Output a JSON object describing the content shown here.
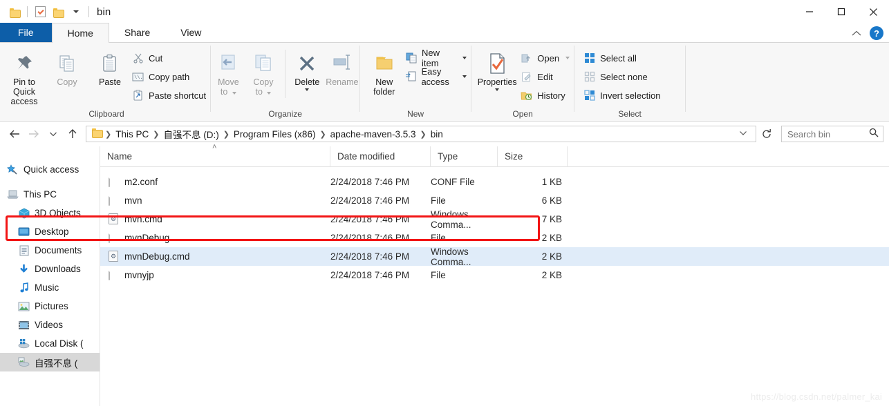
{
  "window": {
    "title": "bin",
    "quick_access_icons": [
      "folder-icon",
      "properties-check-icon",
      "new-folder-icon",
      "customize-caret-icon"
    ],
    "controls": {
      "minimize": "—",
      "maximize": "□",
      "close": "✕"
    }
  },
  "ribbon": {
    "tabs": [
      {
        "label": "File",
        "state": "file"
      },
      {
        "label": "Home",
        "state": "active"
      },
      {
        "label": "Share",
        "state": "normal"
      },
      {
        "label": "View",
        "state": "normal"
      }
    ],
    "collapse_icon": "chevron-up-icon",
    "help_label": "?",
    "groups": [
      {
        "name": "Clipboard",
        "big": [
          {
            "label_line1": "Pin to Quick",
            "label_line2": "access",
            "icon": "pin-icon",
            "dim": false
          },
          {
            "label_line1": "Copy",
            "label_line2": "",
            "icon": "copy-icon",
            "dim": true
          },
          {
            "label_line1": "Paste",
            "label_line2": "",
            "icon": "paste-icon",
            "dim": false
          }
        ],
        "small": [
          {
            "label": "Cut",
            "icon": "scissors-icon",
            "dim": true,
            "caret": false
          },
          {
            "label": "Copy path",
            "icon": "copy-path-icon",
            "dim": false,
            "caret": false
          },
          {
            "label": "Paste shortcut",
            "icon": "paste-shortcut-icon",
            "dim": true,
            "caret": false
          }
        ]
      },
      {
        "name": "Organize",
        "big": [
          {
            "label_line1": "Move",
            "label_line2": "to",
            "icon": "move-to-icon",
            "dim": true,
            "caret": true
          },
          {
            "label_line1": "Copy",
            "label_line2": "to",
            "icon": "copy-to-icon",
            "dim": true,
            "caret": true
          },
          {
            "label_line1": "Delete",
            "label_line2": "",
            "icon": "delete-x-icon",
            "dim": false,
            "caret": true
          },
          {
            "label_line1": "Rename",
            "label_line2": "",
            "icon": "rename-icon",
            "dim": true,
            "caret": false
          }
        ],
        "small": []
      },
      {
        "name": "New",
        "big": [
          {
            "label_line1": "New",
            "label_line2": "folder",
            "icon": "new-folder-icon",
            "dim": false
          }
        ],
        "small": [
          {
            "label": "New item",
            "icon": "new-item-icon",
            "dim": false,
            "caret": true
          },
          {
            "label": "Easy access",
            "icon": "easy-access-icon",
            "dim": false,
            "caret": true
          }
        ]
      },
      {
        "name": "Open",
        "big": [
          {
            "label_line1": "Properties",
            "label_line2": "",
            "icon": "properties-icon",
            "dim": false,
            "caret": true
          }
        ],
        "small": [
          {
            "label": "Open",
            "icon": "open-icon",
            "dim": true,
            "caret": true
          },
          {
            "label": "Edit",
            "icon": "edit-icon",
            "dim": true,
            "caret": false
          },
          {
            "label": "History",
            "icon": "history-icon",
            "dim": false,
            "caret": false
          }
        ]
      },
      {
        "name": "Select",
        "big": [],
        "small": [
          {
            "label": "Select all",
            "icon": "select-all-icon",
            "dim": false,
            "caret": false
          },
          {
            "label": "Select none",
            "icon": "select-none-icon",
            "dim": false,
            "caret": false
          },
          {
            "label": "Invert selection",
            "icon": "invert-selection-icon",
            "dim": false,
            "caret": false
          }
        ]
      }
    ]
  },
  "addressbar": {
    "back_icon": "arrow-left-icon",
    "forward_icon": "arrow-right-icon",
    "recent_icon": "chevron-down-icon",
    "up_icon": "arrow-up-icon",
    "folder_icon": "folder-icon",
    "breadcrumbs": [
      "This PC",
      "自强不息 (D:)",
      "Program Files (x86)",
      "apache-maven-3.5.3",
      "bin"
    ],
    "dropdown_icon": "chevron-down-icon",
    "refresh_icon": "refresh-icon",
    "search_placeholder": "Search bin",
    "search_value": "",
    "search_icon": "search-icon"
  },
  "navpane": {
    "items": [
      {
        "label": "Quick access",
        "icon": "star-pin-icon",
        "indent": false,
        "selected": false
      },
      {
        "label": "This PC",
        "icon": "computer-icon",
        "indent": false,
        "selected": false
      },
      {
        "label": "3D Objects",
        "icon": "3d-objects-icon",
        "indent": true,
        "selected": false
      },
      {
        "label": "Desktop",
        "icon": "desktop-icon",
        "indent": true,
        "selected": false
      },
      {
        "label": "Documents",
        "icon": "documents-icon",
        "indent": true,
        "selected": false
      },
      {
        "label": "Downloads",
        "icon": "downloads-icon",
        "indent": true,
        "selected": false
      },
      {
        "label": "Music",
        "icon": "music-icon",
        "indent": true,
        "selected": false
      },
      {
        "label": "Pictures",
        "icon": "pictures-icon",
        "indent": true,
        "selected": false
      },
      {
        "label": "Videos",
        "icon": "videos-icon",
        "indent": true,
        "selected": false
      },
      {
        "label": "Local Disk (",
        "icon": "local-disk-icon",
        "indent": true,
        "selected": false
      },
      {
        "label": "自强不息 (",
        "icon": "network-drive-icon",
        "indent": true,
        "selected": true
      }
    ]
  },
  "filelist": {
    "columns": [
      "Name",
      "Date modified",
      "Type",
      "Size"
    ],
    "sort_indicator": "˄",
    "rows": [
      {
        "name": "m2.conf",
        "date": "2/24/2018 7:46 PM",
        "type": "CONF File",
        "size": "1 KB",
        "icon": "plain-file-icon",
        "selected": false,
        "highlighted": false
      },
      {
        "name": "mvn",
        "date": "2/24/2018 7:46 PM",
        "type": "File",
        "size": "6 KB",
        "icon": "plain-file-icon",
        "selected": false,
        "highlighted": false
      },
      {
        "name": "mvn.cmd",
        "date": "2/24/2018 7:46 PM",
        "type": "Windows Comma...",
        "size": "7 KB",
        "icon": "cmd-file-icon",
        "selected": false,
        "highlighted": true
      },
      {
        "name": "mvnDebug",
        "date": "2/24/2018 7:46 PM",
        "type": "File",
        "size": "2 KB",
        "icon": "plain-file-icon",
        "selected": false,
        "highlighted": false
      },
      {
        "name": "mvnDebug.cmd",
        "date": "2/24/2018 7:46 PM",
        "type": "Windows Comma...",
        "size": "2 KB",
        "icon": "cmd-file-icon",
        "selected": true,
        "highlighted": false
      },
      {
        "name": "mvnyjp",
        "date": "2/24/2018 7:46 PM",
        "type": "File",
        "size": "2 KB",
        "icon": "plain-file-icon",
        "selected": false,
        "highlighted": false
      }
    ]
  },
  "watermark": {
    "text": "https://blog.csdn.net/palmer_kai"
  },
  "colors": {
    "file_tab_blue": "#0d5ea8",
    "highlight_red": "#f21414",
    "selection_blue": "#e0ecf9",
    "nav_selected_gray": "#d8d8d8"
  }
}
